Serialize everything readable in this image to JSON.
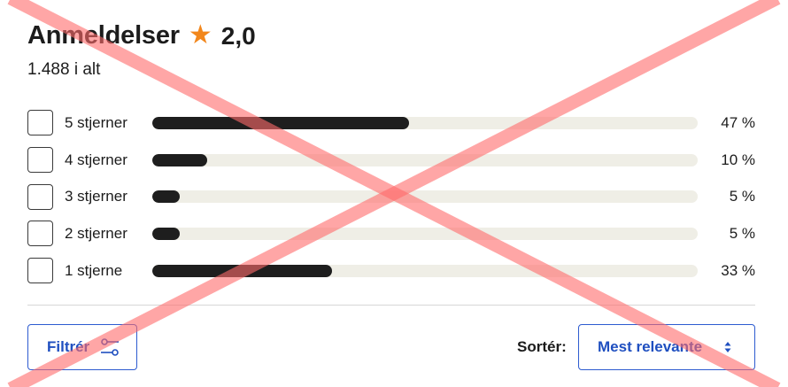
{
  "header": {
    "title": "Anmeldelser",
    "star_symbol": "★",
    "star_color": "#f2871c",
    "rating": "2,0",
    "total": "1.488 i alt"
  },
  "distribution": [
    {
      "label": "5 stjerner",
      "percent_text": "47 %",
      "fraction": 0.47
    },
    {
      "label": "4 stjerner",
      "percent_text": "10 %",
      "fraction": 0.1
    },
    {
      "label": "3 stjerner",
      "percent_text": "5 %",
      "fraction": 0.05
    },
    {
      "label": "2 stjerner",
      "percent_text": "5 %",
      "fraction": 0.05
    },
    {
      "label": "1 stjerne",
      "percent_text": "33 %",
      "fraction": 0.33
    }
  ],
  "controls": {
    "filter_label": "Filtrér",
    "filter_icon": "sliders-icon",
    "sort_label": "Sortér:",
    "sort_value": "Mest relevante",
    "sort_icon": "sort-arrows-icon",
    "accent_color": "#1f4fc0"
  },
  "overlay": {
    "icon": "red-x-overlay",
    "color": "#ff6b6b"
  }
}
